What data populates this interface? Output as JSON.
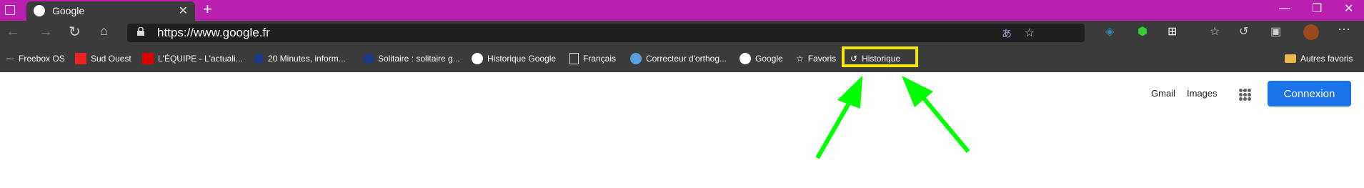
{
  "tab": {
    "title": "Google"
  },
  "address": {
    "url": "https://www.google.fr"
  },
  "bookmarks": [
    {
      "label": "Freebox OS"
    },
    {
      "label": "Sud Ouest"
    },
    {
      "label": "L'ÉQUIPE - L'actuali..."
    },
    {
      "label": "20 Minutes, inform..."
    },
    {
      "label": "Solitaire : solitaire g..."
    },
    {
      "label": "Historique Google"
    },
    {
      "label": "Français"
    },
    {
      "label": "Correcteur d'orthog..."
    },
    {
      "label": "Google"
    },
    {
      "label": "Favoris"
    },
    {
      "label": "Historique"
    },
    {
      "label": "Autres favoris"
    }
  ],
  "page": {
    "gmail": "Gmail",
    "images": "Images",
    "signin": "Connexion"
  },
  "colors": {
    "titlebar": "#bb1fb0",
    "highlight": "#f4e800",
    "arrow": "#00ff00",
    "button": "#1a73e8"
  }
}
